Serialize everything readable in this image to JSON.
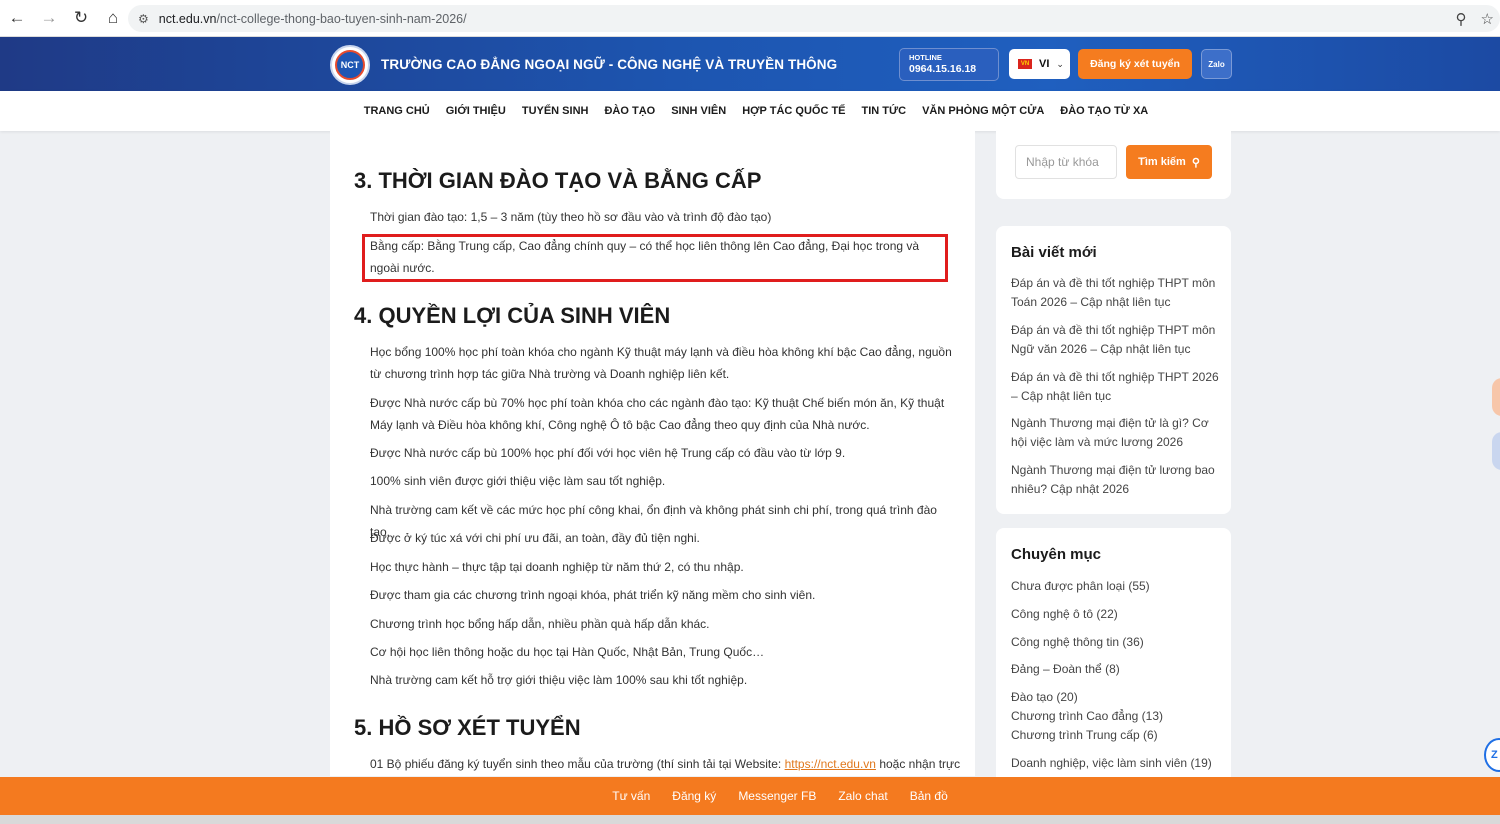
{
  "browser": {
    "url_host": "nct.edu.vn",
    "url_path": "/nct-college-thong-bao-tuyen-sinh-nam-2026/"
  },
  "header": {
    "logo_text": "NCT",
    "school_name": "TRƯỜNG CAO ĐẲNG NGOẠI NGỮ - CÔNG NGHỆ VÀ TRUYỀN THÔNG",
    "hotline_label": "HOTLINE",
    "hotline_number": "0964.15.16.18",
    "lang_flag": "VN",
    "lang_code": "VI",
    "register_label": "Đăng ký xét tuyển",
    "zalo_label": "Zalo"
  },
  "nav": {
    "items": [
      "TRANG CHỦ",
      "GIỚI THIỆU",
      "TUYỂN SINH",
      "ĐÀO TẠO",
      "SINH VIÊN",
      "HỢP TÁC QUỐC TẾ",
      "TIN TỨC",
      "VĂN PHÒNG MỘT CỬA",
      "ĐÀO TẠO TỪ XA"
    ]
  },
  "article": {
    "section3_title": "3. THỜI GIAN ĐÀO TẠO VÀ BẰNG CẤP",
    "section3_p1": "Thời gian đào tạo: 1,5 – 3 năm (tùy theo hồ sơ đầu vào và trình độ đào tạo)",
    "section3_p2": "Bằng cấp: Bằng Trung cấp, Cao đẳng chính quy – có thể học liên thông lên Cao đẳng, Đại học trong và ngoài nước.",
    "section4_title": "4. QUYỀN LỢI CỦA SINH VIÊN",
    "section4_items": [
      "Học bổng 100% học phí toàn khóa cho ngành Kỹ thuật máy lạnh và điều hòa không khí bậc Cao đẳng, nguồn từ chương trình hợp tác giữa Nhà trường và Doanh nghiệp liên kết.",
      "Được Nhà nước cấp bù 70% học phí toàn khóa cho các ngành đào tạo: Kỹ thuật Chế biến món ăn, Kỹ thuật Máy lạnh và Điều hòa không khí, Công nghệ Ô tô bậc Cao đẳng theo quy định của Nhà nước.",
      "Được Nhà nước cấp bù 100% học phí đối với học viên hệ Trung cấp có đầu vào từ lớp 9.",
      "100% sinh viên được giới thiệu việc làm sau tốt nghiệp.",
      "Nhà trường cam kết về các mức học phí công khai, ổn định và không phát sinh chi phí, trong quá trình đào tạo.",
      "Được ở ký túc xá với chi phí ưu đãi, an toàn, đầy đủ tiện nghi.",
      "Học thực hành – thực tập tại doanh nghiệp từ năm thứ 2, có thu nhập.",
      "Được tham gia các chương trình ngoại khóa, phát triển kỹ năng mềm cho sinh viên.",
      "Chương trình học bổng hấp dẫn, nhiều phần quà hấp dẫn khác.",
      "Cơ hội học liên thông hoặc du học tại Hàn Quốc, Nhật Bản, Trung Quốc…",
      "Nhà trường cam kết hỗ trợ giới thiệu việc làm 100% sau khi tốt nghiệp."
    ],
    "section5_title": "5. HỒ SƠ XÉT TUYỂN",
    "section5_p1_before": "01 Bộ phiếu đăng ký tuyển sinh theo mẫu của trường (thí sinh tải tại Website: ",
    "section5_p1_link": "https://nct.edu.vn",
    "section5_p1_after": " hoặc nhận trực"
  },
  "sidebar": {
    "search_placeholder": "Nhập từ khóa",
    "search_button": "Tìm kiếm",
    "recent_title": "Bài viết mới",
    "recent_posts": [
      "Đáp án và đề thi tốt nghiệp THPT môn Toán 2026 – Cập nhật liên tục",
      "Đáp án và đề thi tốt nghiệp THPT môn Ngữ văn 2026 – Cập nhật liên tục",
      "Đáp án và đề thi tốt nghiệp THPT 2026 – Cập nhật liên tục",
      "Ngành Thương mại điện tử là gì? Cơ hội việc làm và mức lương 2026",
      "Ngành Thương mại điện tử lương bao nhiêu? Cập nhật 2026"
    ],
    "category_title": "Chuyên mục",
    "categories": [
      "Chưa được phân loại (55)",
      "Công nghệ ô tô (22)",
      "Công nghệ thông tin (36)",
      "Đảng – Đoàn thể (8)",
      "Đào tạo (20)",
      "Chương trình Cao đẳng (13)",
      "Chương trình Trung cấp (6)",
      "Doanh nghiệp, việc làm sinh viên (19)"
    ]
  },
  "bottom_bar": {
    "items": [
      "Tư vấn",
      "Đăng ký",
      "Messenger FB",
      "Zalo chat",
      "Bản đồ"
    ]
  },
  "colors": {
    "header_blue": "#1d55b0",
    "accent_orange": "#f57c1f",
    "highlight_red": "#e01d1d"
  }
}
